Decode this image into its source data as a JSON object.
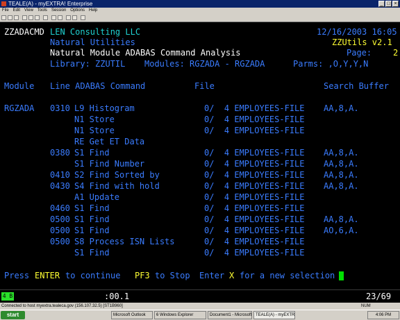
{
  "window": {
    "title": "TEALE(A) - myEXTRA! Enterprise"
  },
  "menu": [
    "File",
    "Edit",
    "View",
    "Tools",
    "Session",
    "Options",
    "Help"
  ],
  "header": {
    "screen_id": "ZZADACMD",
    "company": "LEN Consulting LLC",
    "datetime": "12/16/2003 16:05",
    "subtitle": "Natural Utilities",
    "version": "ZZUtils v2.1",
    "title": "Natural Module ADABAS Command Analysis",
    "page_label": "Page:",
    "page_value": "2",
    "library": "Library: ZZUTIL",
    "modules": "Modules: RGZADA - RGZADA",
    "parms": "Parms: ,O,Y,Y,N"
  },
  "columns": {
    "module": "Module",
    "line_cmd": "Line ADABAS Command",
    "file": "File",
    "search": "Search Buffer"
  },
  "rows": [
    {
      "module": "RGZADA",
      "line": "0310",
      "cmd": "L9 Histogram",
      "file": "0/  4 EMPLOYEES-FILE",
      "search": "AA,8,A."
    },
    {
      "module": "",
      "line": "",
      "cmd": "N1 Store",
      "file": "0/  4 EMPLOYEES-FILE",
      "search": ""
    },
    {
      "module": "",
      "line": "",
      "cmd": "N1 Store",
      "file": "0/  4 EMPLOYEES-FILE",
      "search": ""
    },
    {
      "module": "",
      "line": "",
      "cmd": "RE Get ET Data",
      "file": "",
      "search": ""
    },
    {
      "module": "",
      "line": "0380",
      "cmd": "S1 Find",
      "file": "0/  4 EMPLOYEES-FILE",
      "search": "AA,8,A."
    },
    {
      "module": "",
      "line": "",
      "cmd": "S1 Find Number",
      "file": "0/  4 EMPLOYEES-FILE",
      "search": "AA,8,A."
    },
    {
      "module": "",
      "line": "0410",
      "cmd": "S2 Find Sorted by",
      "file": "0/  4 EMPLOYEES-FILE",
      "search": "AA,8,A."
    },
    {
      "module": "",
      "line": "0430",
      "cmd": "S4 Find with hold",
      "file": "0/  4 EMPLOYEES-FILE",
      "search": "AA,8,A."
    },
    {
      "module": "",
      "line": "",
      "cmd": "A1 Update",
      "file": "0/  4 EMPLOYEES-FILE",
      "search": ""
    },
    {
      "module": "",
      "line": "0460",
      "cmd": "S1 Find",
      "file": "0/  4 EMPLOYEES-FILE",
      "search": ""
    },
    {
      "module": "",
      "line": "0500",
      "cmd": "S1 Find",
      "file": "0/  4 EMPLOYEES-FILE",
      "search": "AA,8,A."
    },
    {
      "module": "",
      "line": "0500",
      "cmd": "S1 Find",
      "file": "0/  4 EMPLOYEES-FILE",
      "search": "AO,6,A."
    },
    {
      "module": "",
      "line": "0500",
      "cmd": "S8 Process ISN Lists",
      "file": "0/  4 EMPLOYEES-FILE",
      "search": ""
    },
    {
      "module": "",
      "line": "",
      "cmd": "S1 Find",
      "file": "0/  4 EMPLOYEES-FILE",
      "search": ""
    }
  ],
  "prompt": {
    "press": "Press",
    "enter": "ENTER",
    "continue": "to continue",
    "pf3": "PF3",
    "stop": "to Stop",
    "enter2": "Enter",
    "x": "X",
    "new_sel": "for a new selection"
  },
  "oia": {
    "box": "4 B",
    "time": ":00.1",
    "cursor_pos": "23/69"
  },
  "statusbar": {
    "left": "Connected to host myextra.tealeca.gov (156.107.32.5) [ST1B960]",
    "right": "NUM"
  },
  "taskbar": {
    "start": "start",
    "tasks": [
      "Microsoft Outlook",
      "6 Windows Explorer",
      "Document1 - Microsoft Word",
      "TEALE(A) - myEXTRA"
    ],
    "clock": "4:06 PM"
  },
  "colors": {
    "cyan": "#1fd1d1",
    "blue": "#3a7cff",
    "white": "#ffffff",
    "yellow": "#ffff33",
    "green": "#2ae02a"
  }
}
